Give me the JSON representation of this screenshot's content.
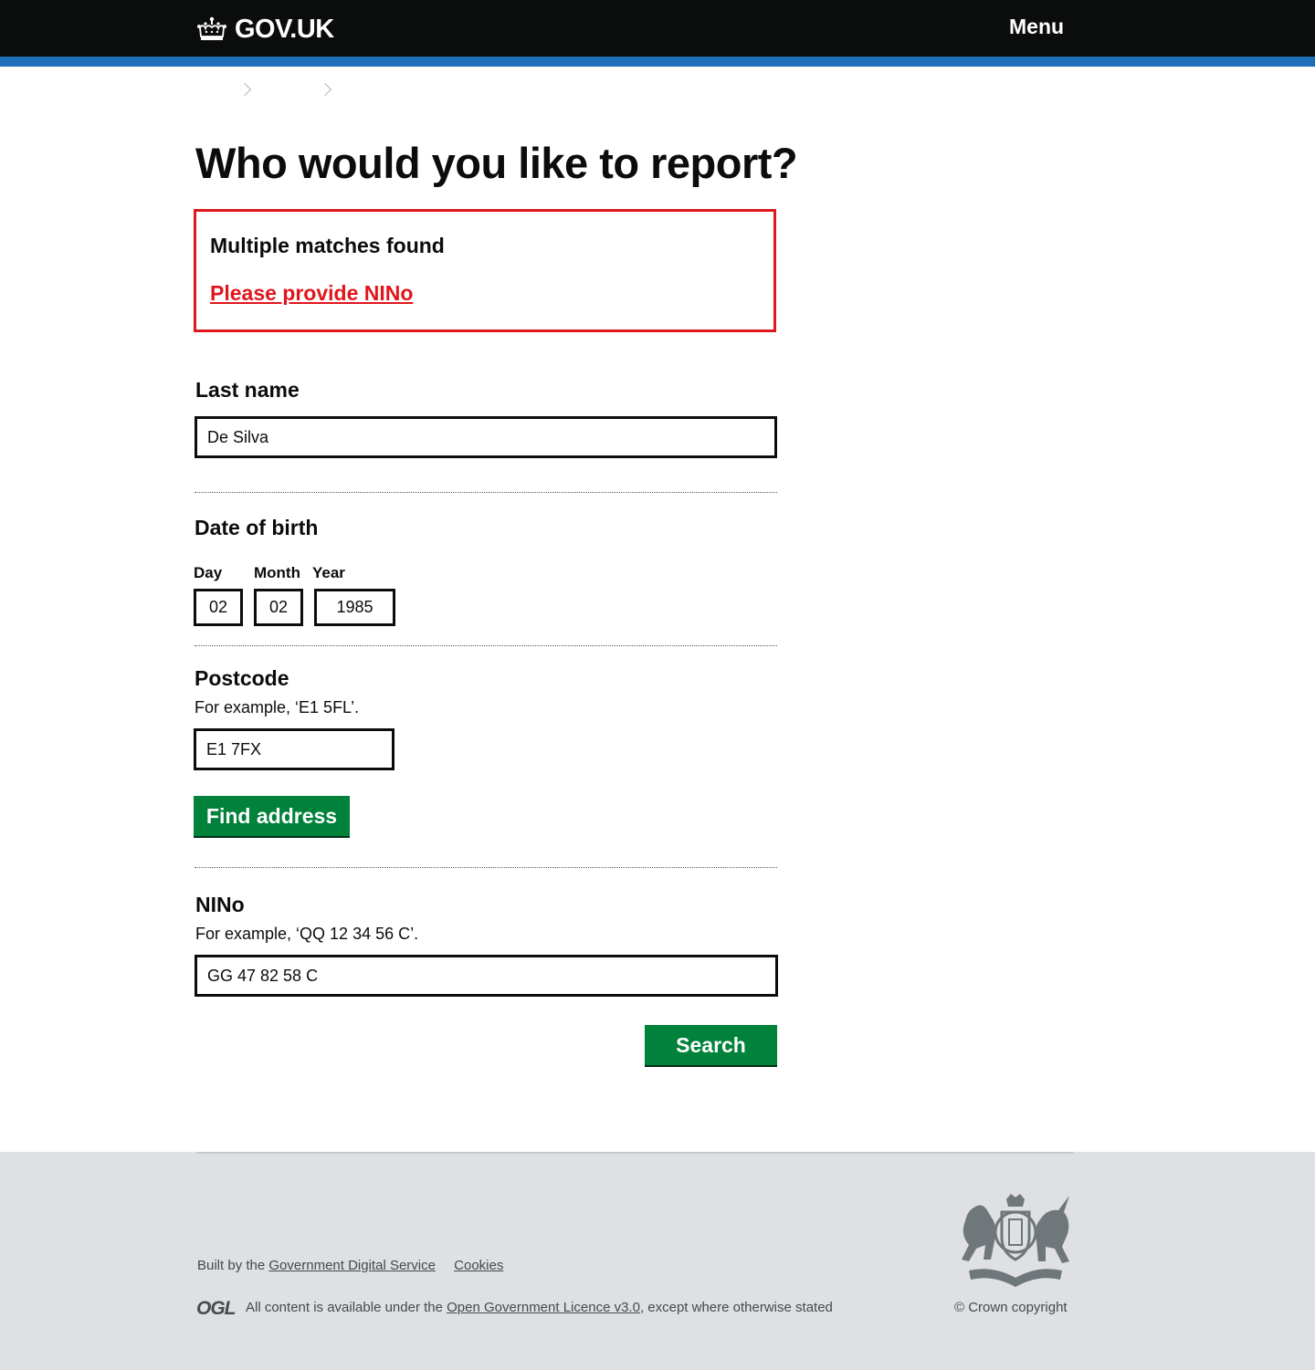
{
  "header": {
    "logo_text": "GOV.UK",
    "menu_label": "Menu"
  },
  "main": {
    "title": "Who would you like to report?",
    "error": {
      "title": "Multiple matches found",
      "link": "Please provide NINo"
    },
    "last_name": {
      "label": "Last name",
      "value": "De Silva"
    },
    "dob": {
      "label": "Date of birth",
      "day_label": "Day",
      "day_value": "02",
      "month_label": "Month",
      "month_value": "02",
      "year_label": "Year",
      "year_value": "1985"
    },
    "postcode": {
      "label": "Postcode",
      "hint": "For example, ‘E1 5FL’.",
      "value": "E1 7FX",
      "button": "Find address"
    },
    "nino": {
      "label": "NINo",
      "hint": "For example, ‘QQ 12 34 56 C’.",
      "value": "GG 47 82 58 C"
    },
    "search_button": "Search"
  },
  "footer": {
    "built_by_prefix": "Built by the ",
    "built_by_link": "Government Digital Service",
    "cookies": "Cookies",
    "ogl_logo": "OGL",
    "licence_prefix": "All content is available under the ",
    "licence_link": "Open Government Licence v3.0",
    "licence_suffix": ", except where otherwise stated",
    "copyright": "© Crown copyright"
  },
  "colors": {
    "header_bg": "#0b0c0c",
    "header_bar": "#1d70b8",
    "error": "#e0161c",
    "button": "#00823b",
    "footer_bg": "#dee0e2"
  }
}
